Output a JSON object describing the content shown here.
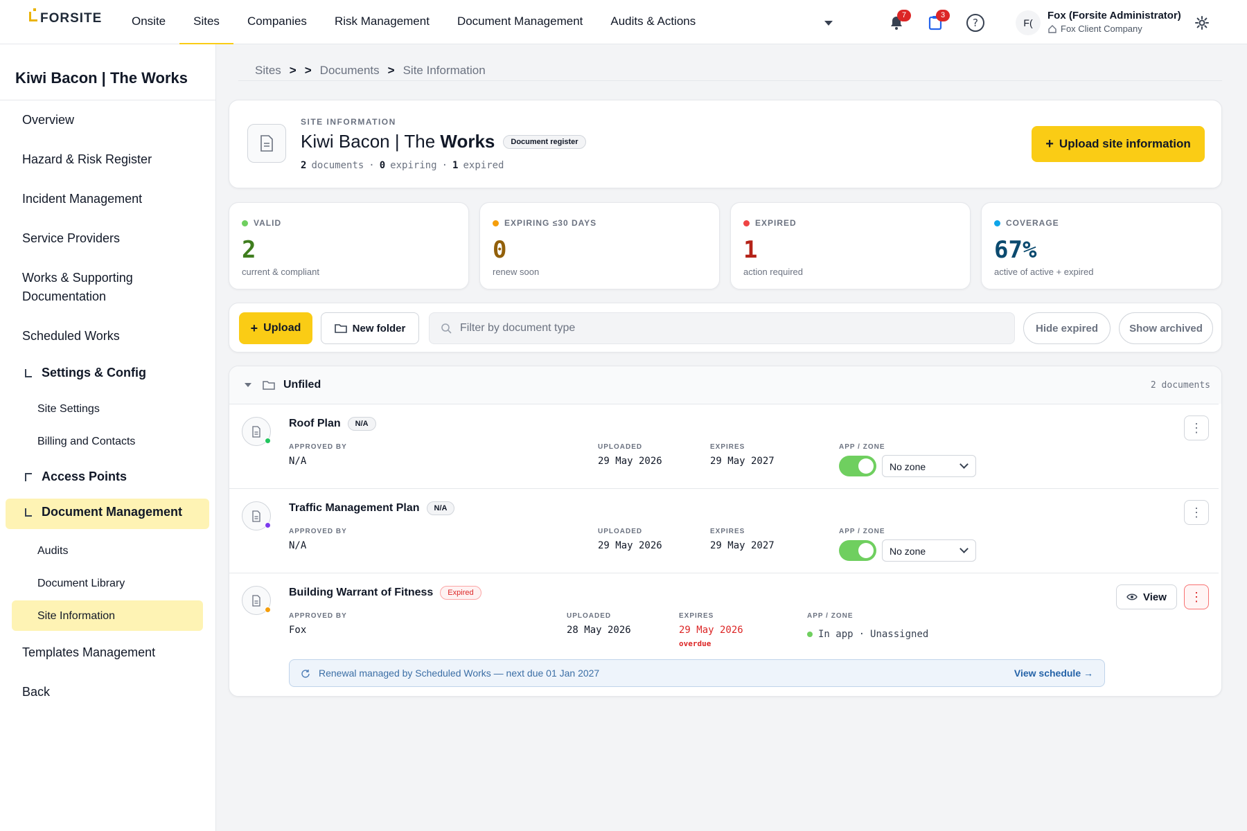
{
  "app": {
    "logo": "FORSITE"
  },
  "nav": {
    "items": [
      "Onsite",
      "Sites",
      "Companies",
      "Risk Management",
      "Document Management",
      "Audits & Actions"
    ],
    "notifications_count": "7",
    "tasks_count": "3"
  },
  "user": {
    "initials": "F(",
    "name": "Fox (Forsite Administrator)",
    "company": "Fox Client Company"
  },
  "sidebar": {
    "site_title": "Kiwi Bacon | The Works",
    "items": [
      "Overview",
      "Hazard & Risk Register",
      "Incident Management",
      "Service Providers",
      "Works & Supporting Documentation",
      "Scheduled Works"
    ],
    "settings_group": "Settings & Config",
    "settings_children": [
      "Site Settings",
      "Billing and Contacts"
    ],
    "access_points": "Access Points",
    "doc_mgmt_group": "Document Management",
    "doc_mgmt_children": [
      "Audits",
      "Document Library",
      "Site Information"
    ],
    "templates": "Templates Management",
    "back": "Back"
  },
  "breadcrumb": {
    "parts": [
      "Sites",
      ">",
      ">",
      "Documents",
      ">",
      "Site Information"
    ]
  },
  "header": {
    "eyebrow": "SITE INFORMATION",
    "title_prefix": "Kiwi Bacon | The ",
    "title_bold": "Works",
    "chip": "Document register",
    "stats_docs_n": "2",
    "stats_docs": "documents",
    "stats_exp_n": "0",
    "stats_exp": "expiring",
    "stats_expd_n": "1",
    "stats_expd": "expired",
    "sep": "·",
    "upload_button": "Upload site information"
  },
  "stats": [
    {
      "label": "VALID",
      "value": "2",
      "sub": "current & compliant",
      "color": "#3f7d1e",
      "dot": "#6fcf5f"
    },
    {
      "label": "EXPIRING ≤30 DAYS",
      "value": "0",
      "sub": "renew soon",
      "color": "#92600a",
      "dot": "#f59e0b"
    },
    {
      "label": "EXPIRED",
      "value": "1",
      "sub": "action required",
      "color": "#b42318",
      "dot": "#ef4444"
    },
    {
      "label": "COVERAGE",
      "value": "67%",
      "sub": "active of active + expired",
      "color": "#0b4a6f",
      "dot": "#0ea5e9"
    }
  ],
  "toolbar": {
    "upload": "Upload",
    "new_folder": "New folder",
    "filter_placeholder": "Filter by document type",
    "hide_expired": "Hide expired",
    "show_archived": "Show archived"
  },
  "folder": {
    "name": "Unfiled",
    "count": "2 documents",
    "labels": {
      "approved_by": "APPROVED BY",
      "uploaded": "UPLOADED",
      "expires": "EXPIRES",
      "app_zone": "APP / ZONE"
    },
    "documents": [
      {
        "title": "Roof Plan",
        "chip": "N/A",
        "approved_by": "N/A",
        "uploaded": "29 May 2026",
        "expires": "29 May 2027",
        "zone": "No zone",
        "dot": "#22c55e"
      },
      {
        "title": "Traffic Management Plan",
        "chip": "N/A",
        "approved_by": "N/A",
        "uploaded": "29 May 2026",
        "expires": "29 May 2027",
        "zone": "No zone",
        "dot": "#7c3aed"
      },
      {
        "title": "Building Warrant of Fitness",
        "chip": "Expired",
        "approved_by": "Fox",
        "uploaded": "28 May 2026",
        "expires": "29 May 2026",
        "overdue": "overdue",
        "app_status": "In app",
        "zone_status": "Unassigned",
        "view": "View",
        "dot": "#f59e0b"
      }
    ]
  },
  "renewal": {
    "text": "Renewal managed by Scheduled Works — next due 01 Jan 2027",
    "link": "View schedule →"
  }
}
